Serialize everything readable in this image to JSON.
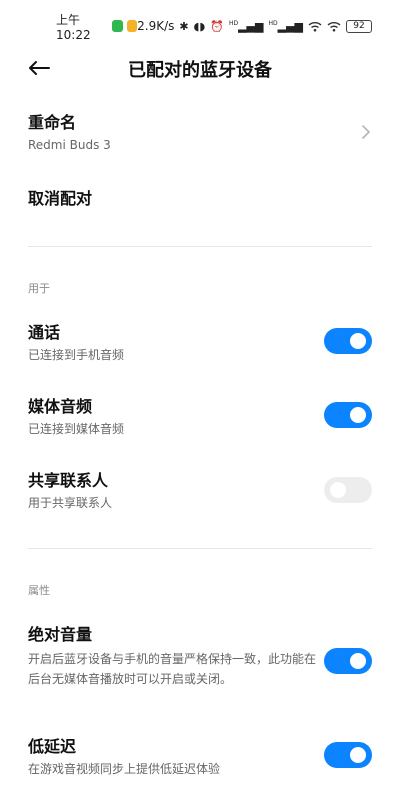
{
  "status_bar": {
    "time": "上午10:22",
    "network_speed": "2.9K/s",
    "signal_label_1": "HD",
    "signal_label_2": "HD",
    "battery": "92"
  },
  "header": {
    "title": "已配对的蓝牙设备"
  },
  "device": {
    "rename_label": "重命名",
    "device_name": "Redmi Buds 3",
    "unpair_label": "取消配对"
  },
  "sections": {
    "used_for": "用于",
    "properties": "属性"
  },
  "settings": [
    {
      "title": "通话",
      "subtitle": "已连接到手机音频",
      "enabled": true
    },
    {
      "title": "媒体音频",
      "subtitle": "已连接到媒体音频",
      "enabled": true
    },
    {
      "title": "共享联系人",
      "subtitle": "用于共享联系人",
      "enabled": false
    },
    {
      "title": "绝对音量",
      "subtitle": "开启后蓝牙设备与手机的音量严格保持一致，此功能在后台无媒体音播放时可以开启或关闭。",
      "enabled": true
    },
    {
      "title": "低延迟",
      "subtitle": "在游戏音视频同步上提供低延迟体验",
      "enabled": true
    }
  ],
  "colors": {
    "toggle_on": "#0d84ff",
    "toggle_off": "#ededed"
  }
}
